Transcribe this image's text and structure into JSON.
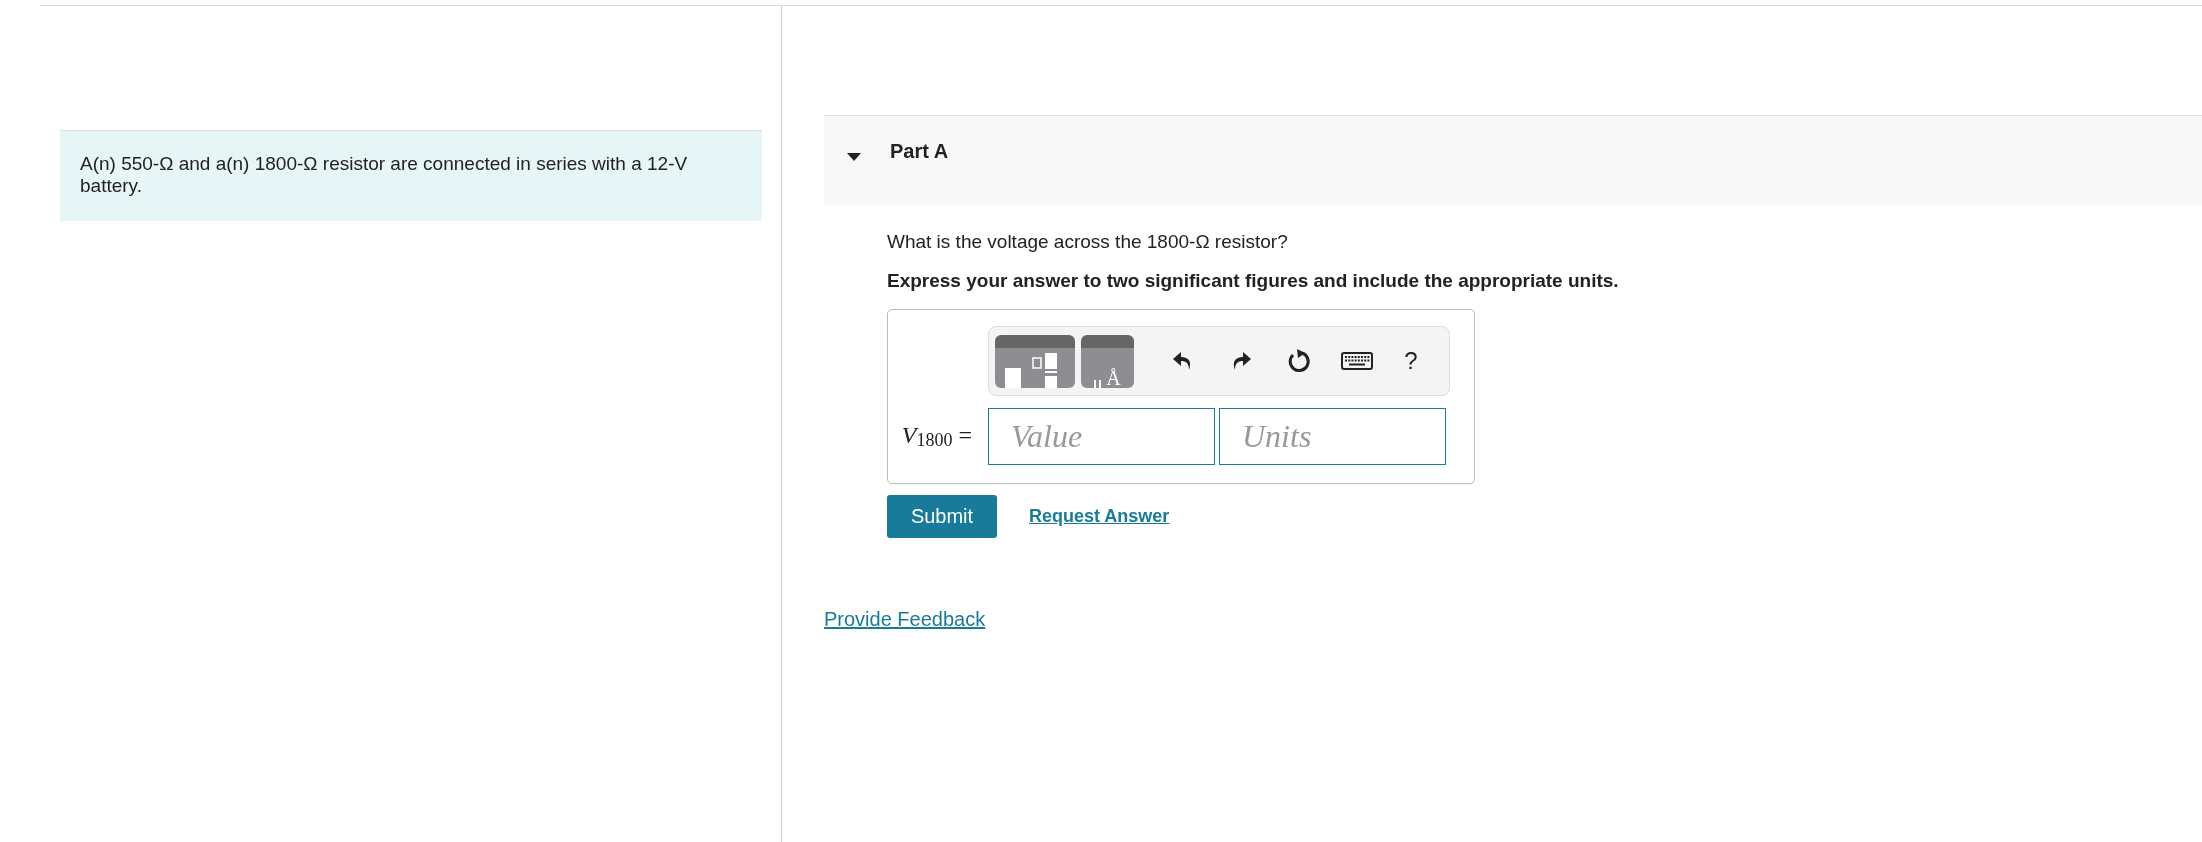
{
  "problem": {
    "text": "A(n) 550-Ω and a(n) 1800-Ω resistor are connected in series with a 12-V battery."
  },
  "part": {
    "title": "Part A",
    "expanded": true,
    "question": "What is the voltage across the 1800-Ω resistor?",
    "instruction": "Express your answer to two significant figures and include the appropriate units.",
    "toolbar": [
      {
        "kind": "templates"
      },
      {
        "kind": "units",
        "label": "Å"
      },
      {
        "kind": "undo"
      },
      {
        "kind": "redo"
      },
      {
        "kind": "reset"
      },
      {
        "kind": "keyboard"
      },
      {
        "kind": "help",
        "label": "?"
      }
    ],
    "answer_label": "*V*$_{1800}$ =",
    "value_field": {
      "placeholder": "Value"
    },
    "units_field": {
      "placeholder": "Units"
    },
    "submit": "Submit",
    "request": "Request Answer"
  },
  "feedback_link": "Provide Feedback"
}
